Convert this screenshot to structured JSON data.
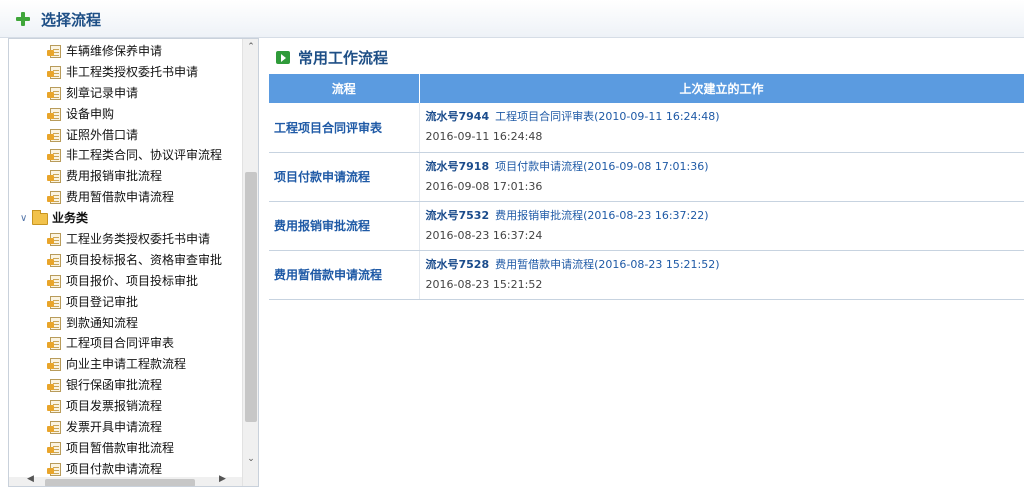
{
  "header": {
    "title": "选择流程"
  },
  "tree": {
    "items_before": [
      "车辆维修保养申请",
      "非工程类授权委托书申请",
      "刻章记录申请",
      "设备申购",
      "证照外借口请",
      "非工程类合同、协议评审流程",
      "费用报销审批流程",
      "费用暂借款申请流程"
    ],
    "folder": {
      "label": "业务类",
      "toggle_icon": "chevron-down-icon"
    },
    "items_after": [
      "工程业务类授权委托书申请",
      "项目投标报名、资格审查审批",
      "项目报价、项目投标审批",
      "项目登记审批",
      "到款通知流程",
      "工程项目合同评审表",
      "向业主申请工程款流程",
      "银行保函审批流程",
      "项目发票报销流程",
      "发票开具申请流程",
      "项目暂借款审批流程",
      "项目付款申请流程"
    ]
  },
  "main": {
    "section_title": "常用工作流程",
    "columns": [
      "流程",
      "上次建立的工作"
    ],
    "rows": [
      {
        "flow": "工程项目合同评审表",
        "serial": "流水号7944",
        "work": "工程项目合同评审表(2010-09-11 16:24:48)",
        "time": "2016-09-11 16:24:48"
      },
      {
        "flow": "项目付款申请流程",
        "serial": "流水号7918",
        "work": "项目付款申请流程(2016-09-08 17:01:36)",
        "time": "2016-09-08 17:01:36"
      },
      {
        "flow": "费用报销审批流程",
        "serial": "流水号7532",
        "work": "费用报销审批流程(2016-08-23 16:37:22)",
        "time": "2016-08-23 16:37:24"
      },
      {
        "flow": "费用暂借款申请流程",
        "serial": "流水号7528",
        "work": "费用暂借款申请流程(2016-08-23 15:21:52)",
        "time": "2016-08-23 15:21:52"
      }
    ]
  }
}
